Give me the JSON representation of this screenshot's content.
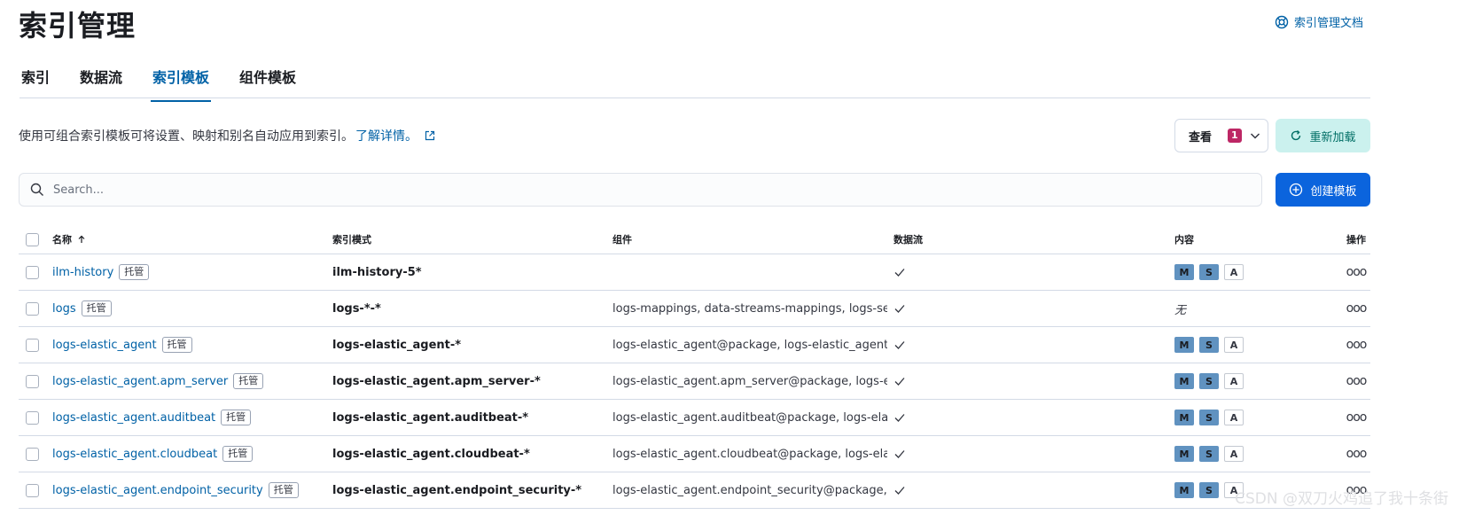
{
  "title": "索引管理",
  "docs_link": "索引管理文档",
  "tabs": [
    {
      "label": "索引"
    },
    {
      "label": "数据流"
    },
    {
      "label": "索引模板"
    },
    {
      "label": "组件模板"
    }
  ],
  "active_tab": 2,
  "description": "使用可组合索引模板可将设置、映射和别名自动应用到索引。",
  "learn_more": "了解详情。",
  "view_button": {
    "label": "查看",
    "badge": "1"
  },
  "reload_button": "重新加载",
  "search": {
    "placeholder": "Search...",
    "value": ""
  },
  "create_button": "创建模板",
  "table": {
    "headers": {
      "name": "名称",
      "pattern": "索引模式",
      "components": "组件",
      "data_stream": "数据流",
      "content": "内容",
      "actions": "操作"
    },
    "managed_label": "托管",
    "none_label": "无",
    "tags": {
      "m": "M",
      "s": "S",
      "a": "A"
    },
    "actions_label": "ooo",
    "rows": [
      {
        "name": "ilm-history",
        "pattern": "ilm-history-5*",
        "components": "",
        "content": "tags"
      },
      {
        "name": "logs",
        "pattern": "logs-*-*",
        "components": "logs-mappings, data-streams-mappings, logs-se",
        "content": "none"
      },
      {
        "name": "logs-elastic_agent",
        "pattern": "logs-elastic_agent-*",
        "components": "logs-elastic_agent@package, logs-elastic_agent(",
        "content": "tags"
      },
      {
        "name": "logs-elastic_agent.apm_server",
        "pattern": "logs-elastic_agent.apm_server-*",
        "components": "logs-elastic_agent.apm_server@package, logs-el",
        "content": "tags"
      },
      {
        "name": "logs-elastic_agent.auditbeat",
        "pattern": "logs-elastic_agent.auditbeat-*",
        "components": "logs-elastic_agent.auditbeat@package, logs-elas",
        "content": "tags"
      },
      {
        "name": "logs-elastic_agent.cloudbeat",
        "pattern": "logs-elastic_agent.cloudbeat-*",
        "components": "logs-elastic_agent.cloudbeat@package, logs-elas",
        "content": "tags"
      },
      {
        "name": "logs-elastic_agent.endpoint_security",
        "pattern": "logs-elastic_agent.endpoint_security-*",
        "components": "logs-elastic_agent.endpoint_security@package, l",
        "content": "tags"
      }
    ]
  },
  "watermark": "CSDN @双刀火鸡追了我十条街",
  "colors": {
    "link": "#0061a6",
    "primary": "#0b64dd",
    "reload_bg": "#cbf1ee",
    "badge": "#bd2765",
    "tag": "#6092c0"
  }
}
